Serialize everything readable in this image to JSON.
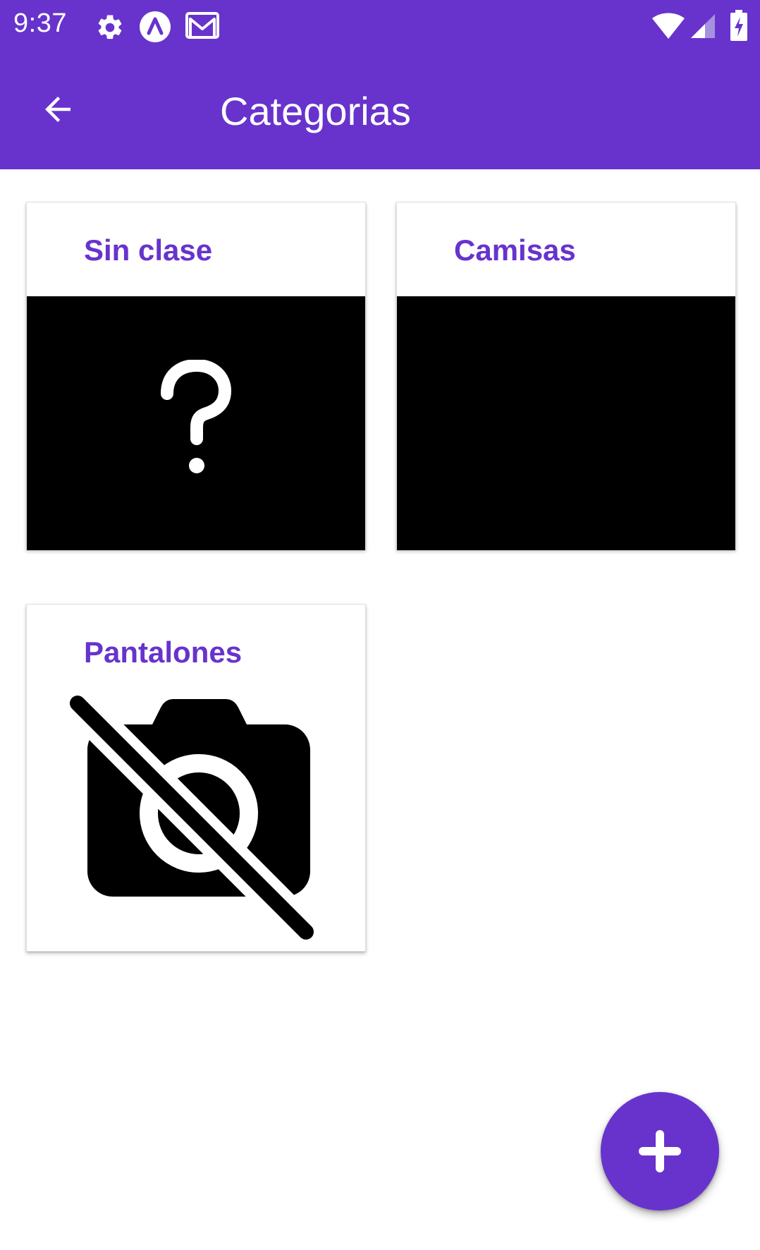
{
  "status_bar": {
    "time": "9:37",
    "icons": [
      "settings-icon",
      "app-badge-icon",
      "gmail-icon",
      "wifi-icon",
      "signal-icon",
      "battery-charging-icon"
    ]
  },
  "app_bar": {
    "title": "Categorias",
    "back_icon": "arrow-back-icon"
  },
  "categories": [
    {
      "name": "Sin clase",
      "image": "question-mark-icon"
    },
    {
      "name": "Camisas",
      "image": "black-placeholder"
    },
    {
      "name": "Pantalones",
      "image": "no-photography-icon"
    }
  ],
  "fab": {
    "icon": "add-icon"
  },
  "colors": {
    "primary": "#6733cc",
    "background": "#ffffff",
    "on_primary": "#ffffff"
  }
}
